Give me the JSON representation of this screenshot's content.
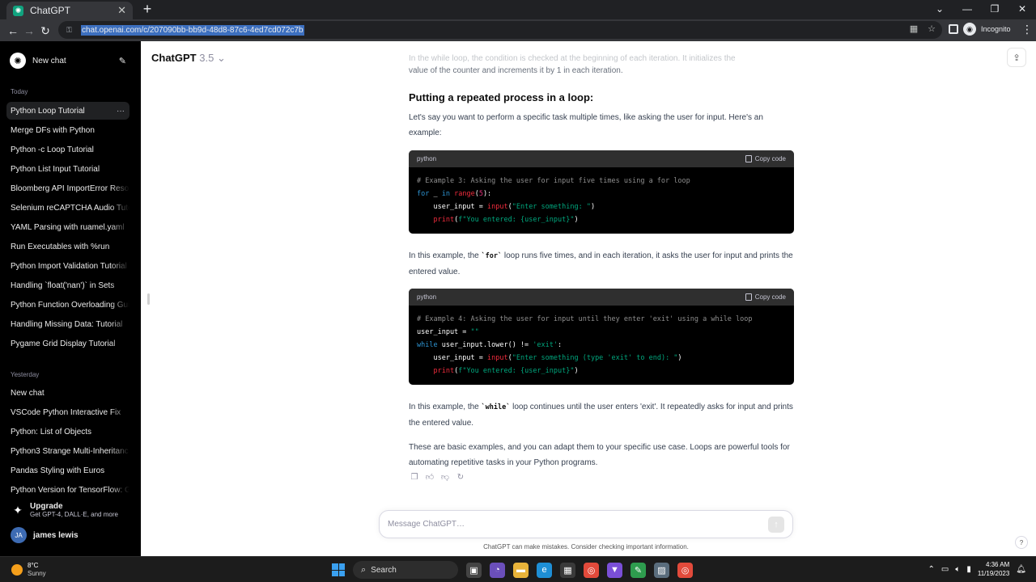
{
  "browser": {
    "tab_title": "ChatGPT",
    "url": "chat.openai.com/c/207090bb-bb9d-48d8-87c6-4ed7cd072c7b",
    "profile_label": "Incognito"
  },
  "sidebar": {
    "new_chat": "New chat",
    "today_label": "Today",
    "today_items": [
      "Python Loop Tutorial",
      "Merge DFs with Python",
      "Python -c Loop Tutorial",
      "Python List Input Tutorial",
      "Bloomberg API ImportError Reso",
      "Selenium reCAPTCHA Audio Tuto",
      "YAML Parsing with ruamel.yaml",
      "Run Executables with %run",
      "Python Import Validation Tutorial",
      "Handling `float('nan')` in Sets",
      "Python Function Overloading Gui",
      "Handling Missing Data: Tutorial",
      "Pygame Grid Display Tutorial"
    ],
    "yesterday_label": "Yesterday",
    "yesterday_items": [
      "New chat",
      "VSCode Python Interactive Fix",
      "Python: List of Objects",
      "Python3 Strange Multi-Inheritanc",
      "Pandas Styling with Euros",
      "Python Version for TensorFlow: G"
    ],
    "upgrade_title": "Upgrade",
    "upgrade_sub": "Get GPT-4, DALL·E, and more",
    "user_initials": "JA",
    "user_name": "james lewis"
  },
  "main": {
    "model_name": "ChatGPT",
    "model_version": "3.5",
    "faded_line": "In the while loop, the condition is checked at the beginning of each iteration. It initializes the",
    "faded_line2": "value of the counter and increments it by 1 in each iteration.",
    "heading": "Putting a repeated process in a loop:",
    "intro": "Let's say you want to perform a specific task multiple times, like asking the user for input. Here's an example:",
    "code1_lang": "python",
    "copy_label": "Copy code",
    "code1_comment": "# Example 3: Asking the user for input five times using a for loop",
    "para2_pre": "In this example, the ",
    "para2_code": "`for`",
    "para2_post": " loop runs five times, and in each iteration, it asks the user for input and prints the entered value.",
    "code2_lang": "python",
    "code2_comment": "# Example 4: Asking the user for input until they enter 'exit' using a while loop",
    "para3_pre": "In this example, the ",
    "para3_code": "`while`",
    "para3_post": " loop continues until the user enters 'exit'. It repeatedly asks for input and prints the entered value.",
    "para4": "These are basic examples, and you can adapt them to your specific use case. Loops are powerful tools for automating repetitive tasks in your Python programs.",
    "composer_placeholder": "Message ChatGPT…",
    "disclaimer": "ChatGPT can make mistakes. Consider checking important information."
  },
  "taskbar": {
    "temp": "8°C",
    "weather": "Sunny",
    "search": "Search",
    "time": "4:36 AM",
    "date": "11/19/2023"
  }
}
